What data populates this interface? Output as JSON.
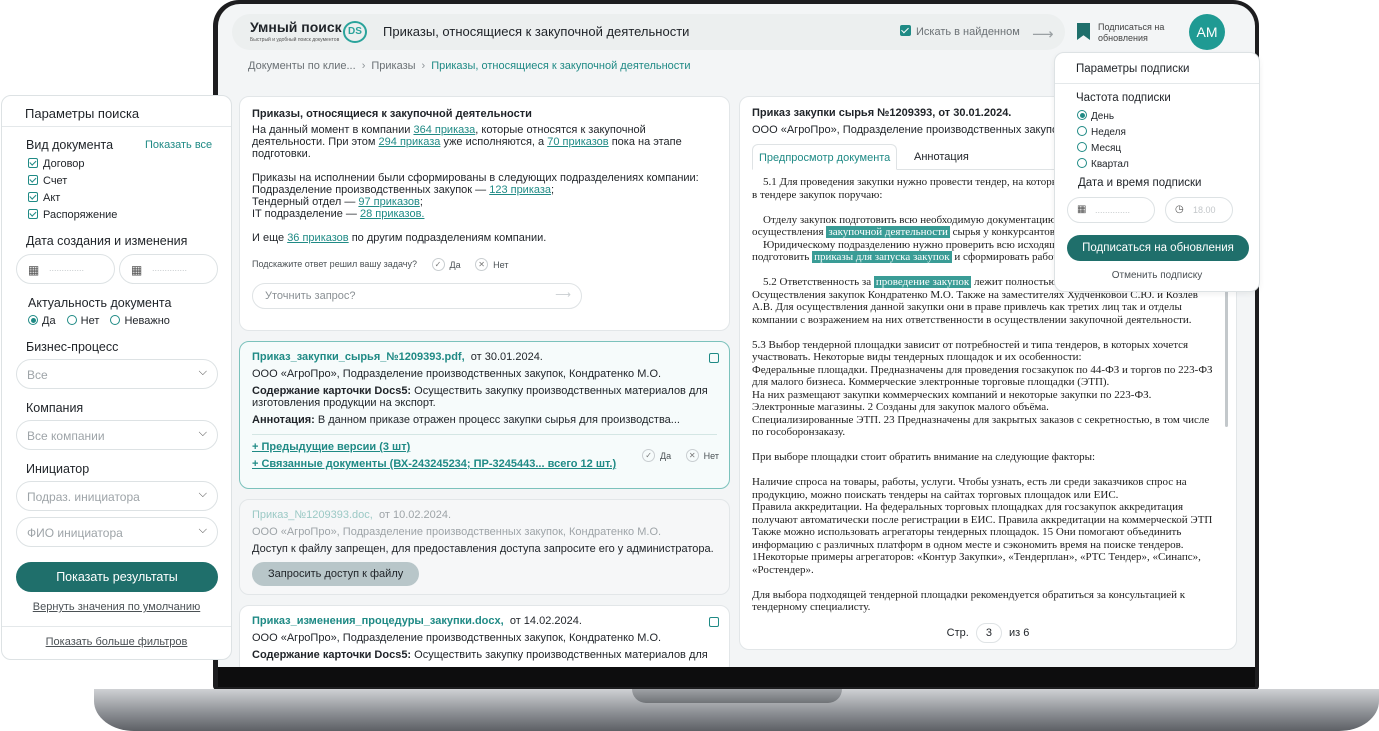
{
  "header": {
    "logo_title": "Умный поиск",
    "logo_subtitle": "Быстрый и удобный поиск документов",
    "logo_badge": "DS",
    "page_title": "Приказы, относящиеся к закупочной деятельности",
    "search_in_found": "Искать в найденном",
    "subscribe": "Подписаться на обновления",
    "avatar": "АМ"
  },
  "breadcrumbs": [
    "Документы по клие...",
    "Приказы",
    "Приказы, относящиеся к закупочной деятельности"
  ],
  "summary": {
    "title": "Приказы, относящиеся к закупочной деятельности",
    "p1_a": "На данный момент в компании ",
    "p1_link1": "364 приказа",
    "p1_b": ", которые относятся к закупочной деятельности. При этом ",
    "p1_link2": "294 приказа",
    "p1_c": " уже исполняются, а ",
    "p1_link3": "70 приказов",
    "p1_d": " пока на этапе подготовки.",
    "p2_intro": "Приказы на исполнении были сформированы в следующих подразделениях компании:",
    "p2_l1": "Подразделение производственных закупок — ",
    "p2_l1_link": "123 приказа",
    "p2_l2": "Тендерный отдел — ",
    "p2_l2_link": "97 приказов",
    "p2_l3": "IT подразделение — ",
    "p2_l3_link": "28 приказов.",
    "p3_a": "И еще ",
    "p3_link": "36 приказов",
    "p3_b": " по другим подразделениям компании.",
    "helpful": "Подскажите ответ решил вашу задачу?",
    "yes": "Да",
    "no": "Нет",
    "refine_placeholder": "Уточнить запрос?"
  },
  "results": [
    {
      "title": "Приказ_закупки_сырья_№1209393.pdf,",
      "date": "от 30.01.2024.",
      "org": "ООО «АгроПро»,  Подразделение производственных закупок,  Кондратенко М.О.",
      "content_label": "Содержание карточки Docs5:",
      "content": " Осуществить закупку производственных материалов для изготовления продукции на экспорт.",
      "annotation_label": "Аннотация:",
      "annotation": " В данном приказе отражен процесс закупки сырья для производства...",
      "link_prev": "+ Предыдущие версии (3 шт)",
      "link_related": "+ Связанные документы (ВХ-243245234; ПР-3245443... всего 12 шт.)",
      "yes": "Да",
      "no": "Нет"
    },
    {
      "title": "Приказ_№1209393.doc,",
      "date": "от 10.02.2024.",
      "org": "ООО «АгроПро»,  Подразделение производственных закупок,  Кондратенко М.О.",
      "notice": "Доступ к файлу запрещен, для предоставления доступа запросите его у администратора.",
      "button": "Запросить доступ к файлу"
    },
    {
      "title": "Приказ_изменения_процедуры_закупки.docx,",
      "date": "от 14.02.2024.",
      "org": "ООО «АгроПро»,  Подразделение производственных закупок,  Кондратенко М.О.",
      "content_label": "Содержание карточки Docs5:",
      "content": " Осуществить закупку производственных материалов для"
    }
  ],
  "document": {
    "title": "Приказ закупки сырья №1209393,  от 30.01.2024.",
    "org": "ООО «АгроПро»,  Подразделение производственных закупок,  Кондратенко М.О.",
    "tab_preview": "Предпросмотр документа",
    "tab_annotation": "Аннотация",
    "s1_line1": "5.1 Для проведения закупки нужно провести тендер, на который приглашаются",
    "s1_line2": "в тендере закупок поручаю:",
    "s2_a": "Отделу закупок подготовить всю необходимую документацию для",
    "s2_b": "осуществления ",
    "s2_hl1": "закупочной деятельности",
    "s2_c": " сырья у конкурсантов",
    "s2_d": "Юридическому подразделению нужно проверить всю исходящую документацию и",
    "s2_e": "подготовить ",
    "s2_hl2": "приказы для запуска закупок",
    "s2_f": " и сформировать рабочие группы.",
    "s3_a": "5.2 Ответственность за ",
    "s3_hl": "проведение закупок",
    "s3_b": " лежит полностью на руководителе отдела",
    "s3_c": "Осуществления закупок Кондратенко М.О. Также на заместителях Худченковой С.Ю. и Козлев А.В. Для осуществления данной закупки они в праве привлечь как третих лиц так и отделы компании с возражением на них ответственности в осуществлении закупочной деятельности.",
    "s4": "5.3 Выбор тендерной площадки зависит от потребностей и типа тендеров, в которых хочется участвовать.  Некоторые виды тендерных площадок и их особенности:",
    "s4_b": "Федеральные площадки. Предназначены для проведения госзакупок по 44-ФЗ и торгов по 223-ФЗ для малого бизнеса. Коммерческие электронные торговые площадки (ЭТП).",
    "s4_c": "На них размещают закупки коммерческих компаний и некоторые закупки по 223-ФЗ.",
    "s4_d": "Электронные магазины. 2 Созданы для закупок малого объёма.",
    "s4_e": "Специализированные ЭТП. 23 Предназначены для закрытых заказов с секретностью, в том числе по гособоронзаказу.",
    "s5": "При выборе площадки стоит обратить внимание на следующие факторы:",
    "s6": "Наличие спроса на товары, работы, услуги. Чтобы узнать, есть ли среди заказчиков спрос на продукцию, можно поискать тендеры на сайтах торговых площадок или ЕИС.",
    "s6_b": "Правила аккредитации. На федеральных торговых площадках для госзакупок аккредитация получают автоматически после регистрации в ЕИС. Правила аккредитации на коммерческой ЭТП",
    "s6_c": "Также можно использовать агрегаторы тендерных площадок. 15 Они помогают объединить информацию с различных платформ в одном месте и сэкономить время на поиске тендеров.",
    "s6_d": "1Некоторые примеры агрегаторов: «Контур Закупки», «Тендерплан», «РТС Тендер», «Синапс», «Ростендер».",
    "s7": "Для выбора подходящей тендерной площадки рекомендуется обратиться за консультацией к тендерному специалисту.",
    "page_label": "Стр.",
    "page_current": "3",
    "page_total": "из 6"
  },
  "filters": {
    "title": "Параметры поиска",
    "doc_type": "Вид документа",
    "show_all": "Показать все",
    "doc_types": [
      "Договор",
      "Счет",
      "Акт",
      "Распоряжение"
    ],
    "date_section": "Дата создания и изменения",
    "date_placeholder": "..............",
    "actuality": "Актуальность документа",
    "actuality_options": [
      "Да",
      "Нет",
      "Неважно"
    ],
    "business_process": "Бизнес-процесс",
    "business_process_value": "Все",
    "company": "Компания",
    "company_value": "Все компании",
    "initiator": "Инициатор",
    "initiator_dept": "Подраз. инициатора",
    "initiator_name": "ФИО инициатора",
    "show_results": "Показать результаты",
    "reset": "Вернуть значения по умолчанию",
    "more_filters": "Показать больше фильтров"
  },
  "subscription": {
    "title": "Параметры подписки",
    "frequency": "Частота подписки",
    "options": [
      "День",
      "Неделя",
      "Месяц",
      "Квартал"
    ],
    "datetime": "Дата и время подписки",
    "date_placeholder": "..............",
    "time_placeholder": "18.00",
    "subscribe_button": "Подписаться на обновления",
    "cancel": "Отменить подписку"
  }
}
